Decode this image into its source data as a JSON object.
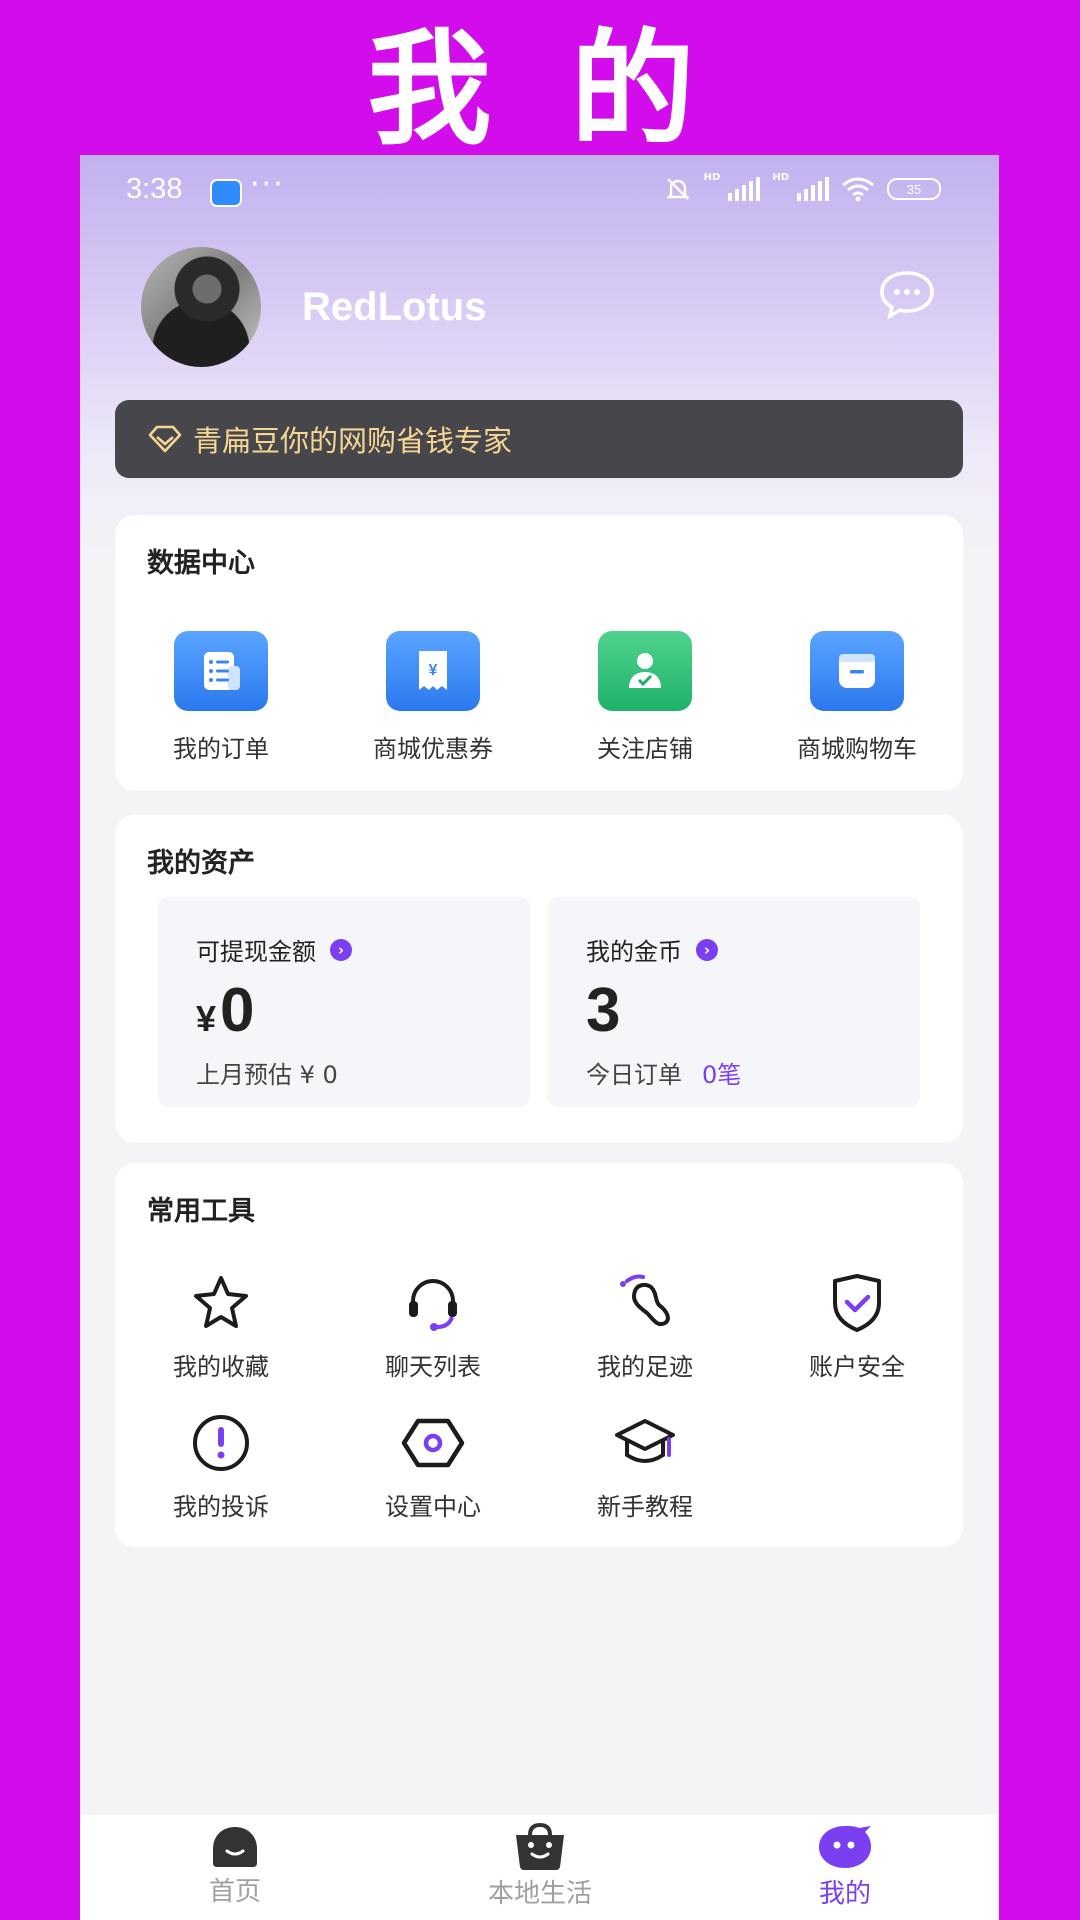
{
  "banner": {
    "title": "我 的"
  },
  "status": {
    "time": "3:38",
    "dots": "···",
    "hd": "HD",
    "battery": "35"
  },
  "profile": {
    "username": "RedLotus"
  },
  "promo": {
    "text": "青扁豆你的网购省钱专家"
  },
  "data_center": {
    "title": "数据中心",
    "items": [
      {
        "label": "我的订单",
        "icon": "order-list-icon"
      },
      {
        "label": "商城优惠券",
        "icon": "coupon-icon"
      },
      {
        "label": "关注店铺",
        "icon": "followed-shop-icon"
      },
      {
        "label": "商城购物车",
        "icon": "cart-icon"
      }
    ]
  },
  "assets": {
    "title": "我的资产",
    "withdrawable": {
      "label": "可提现金额",
      "currency": "¥",
      "value": "0",
      "sub": "上月预估 ¥ 0"
    },
    "coins": {
      "label": "我的金币",
      "value": "3",
      "sub_label": "今日订单",
      "sub_value": "0笔"
    }
  },
  "tools": {
    "title": "常用工具",
    "items": [
      {
        "label": "我的收藏",
        "icon": "star-icon"
      },
      {
        "label": "聊天列表",
        "icon": "headset-icon"
      },
      {
        "label": "我的足迹",
        "icon": "footprint-icon"
      },
      {
        "label": "账户安全",
        "icon": "shield-check-icon"
      },
      {
        "label": "我的投诉",
        "icon": "exclamation-icon"
      },
      {
        "label": "设置中心",
        "icon": "settings-hexagon-icon"
      },
      {
        "label": "新手教程",
        "icon": "graduation-cap-icon"
      }
    ]
  },
  "tabbar": {
    "items": [
      {
        "label": "首页",
        "icon": "home-face-icon"
      },
      {
        "label": "本地生活",
        "icon": "shopping-bag-icon"
      },
      {
        "label": "我的",
        "icon": "profile-bubble-icon",
        "active": true
      }
    ]
  },
  "colors": {
    "frame": "#d20ceb",
    "accent": "#7b3ff2",
    "promo_bg": "#47464a",
    "promo_text": "#f5d692"
  }
}
